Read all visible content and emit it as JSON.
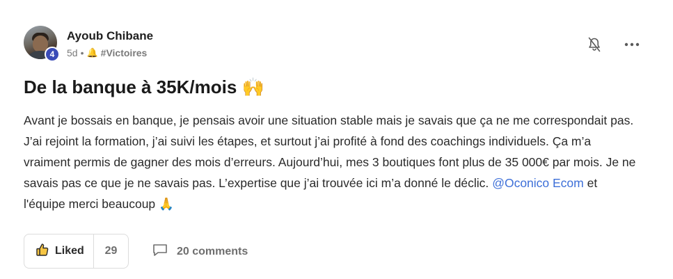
{
  "author": {
    "name": "Ayoub Chibane",
    "level": "4",
    "time_ago": "5d",
    "separator": "•",
    "category": "#Victoires",
    "category_icon": "bell-emoji"
  },
  "post": {
    "title": "De la banque à 35K/mois",
    "title_emoji": "🙌",
    "body_text": "Avant je bossais en banque, je pensais avoir une situation stable mais je savais que ça ne me correspondait pas. J’ai rejoint la formation, j’ai suivi les étapes, et surtout j’ai profité à fond des coachings individuels. Ça m’a vraiment permis de gagner des mois d’erreurs. Aujourd’hui, mes 3 boutiques font plus de 35 000€ par mois. Je ne savais pas ce que je ne savais pas. L’expertise que j’ai trouvée ici m’a donné le déclic.",
    "mention": "@Oconico Ecom",
    "body_end": "et l'équipe merci beaucoup",
    "end_emoji": "🙏"
  },
  "actions": {
    "like_label": "Liked",
    "like_count": "29",
    "comments_label": "20 comments"
  },
  "colors": {
    "accent_blue": "#3d6fd8",
    "badge_blue": "#3a4bb7"
  }
}
